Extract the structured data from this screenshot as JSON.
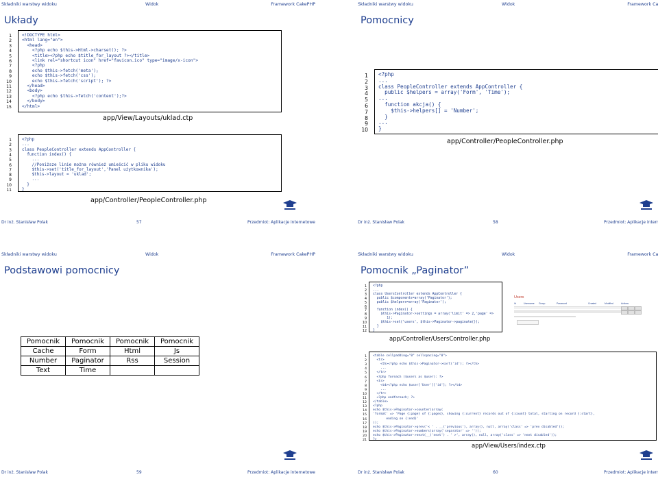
{
  "nav": {
    "left": "Składniki warstwy widoku",
    "mid": "Widok",
    "right": "Framework CakePHP"
  },
  "footer": {
    "author": "Dr inż. Stanisław Polak",
    "course": "Przedmiot: Aplikacje internetowe"
  },
  "slides": [
    {
      "title": "Układy",
      "page": "57",
      "code1": [
        "<!DOCTYPE html>",
        "<html lang=\"en\">",
        "  <head>",
        "    <?php echo $this->Html->charset(); ?>",
        "    <title><?php echo $title_for_layout ?></title>",
        "    <link rel=\"shortcut icon\" href=\"favicon.ico\" type=\"image/x-icon\">",
        "    <?php",
        "    echo $this->fetch('meta');",
        "    echo $this->fetch('css');",
        "    echo $this->fetch('script'); ?>",
        "  </head>",
        "  <body>",
        "    <?php echo $this->fetch('content');?>",
        "  </body>",
        "</html>"
      ],
      "caption1": "app/View/Layouts/uklad.ctp",
      "code2": [
        "<?php",
        "...",
        "class PeopleController extends AppController {",
        "  function index() {",
        "    ...",
        "    //Poniższe linie można również umieścić w pliku widoku",
        "    $this->set('title_for_layout','Panel użytkownika');",
        "    $this->layout = 'uklad';",
        "    ...",
        "  }",
        "}"
      ],
      "caption2": "app/Controller/PeopleController.php"
    },
    {
      "title": "Pomocnicy",
      "page": "58",
      "code": [
        "<?php",
        "...",
        "class PeopleController extends AppController {",
        "  public $helpers = array('Form', 'Time');",
        "...",
        "  function akcja() {",
        "    $this->helpers[] = 'Number';",
        "  }",
        "...",
        "}"
      ],
      "caption": "app/Controller/PeopleController.php"
    },
    {
      "title": "Podstawowi pomocnicy",
      "page": "59",
      "table": [
        [
          "Pomocnik",
          "Pomocnik",
          "Pomocnik",
          "Pomocnik"
        ],
        [
          "Cache",
          "Form",
          "Html",
          "Js"
        ],
        [
          "Number",
          "Paginator",
          "Rss",
          "Session"
        ],
        [
          "Text",
          "Time",
          "",
          ""
        ]
      ]
    },
    {
      "title": "Pomocnik „Paginator”",
      "page": "60",
      "code1": [
        "<?php",
        "...",
        "class UsersController extends AppController {",
        "  public $components=array('Paginator');",
        "  public $helpers=array('Paginator');",
        "",
        "  function index() {",
        "    $this->Paginator->settings = array('limit' => 2,'page' =>",
        "       1);",
        "    $this->set('users', $this->Paginator->paginate());",
        "  }",
        "}"
      ],
      "caption1": "app/Controller/UsersController.php",
      "code2": [
        "<table cellpadding=\"0\" cellspacing=\"0\">",
        "  <tr>",
        "    <th><?php echo $this->Paginator->sort('id'); ?></th>",
        "    ...",
        "  </tr>",
        "  <?php foreach ($users as $user): ?>",
        "  <tr>",
        "    <td><?php echo $user['User']['id']; ?></td>",
        "    ...",
        "  </tr>",
        "  <?php endforeach; ?>",
        "</table>",
        "<?php",
        "echo $this->Paginator->counter(array(",
        "'format' => 'Page {:page} of {:pages}, showing {:current} records out of {:count} total, starting on record {:start},",
        "       ending on {:end}'",
        "));",
        "echo $this->Paginator->prev('< ' . __('previous'), array(), null, array('class' => 'prev disabled'));",
        "echo $this->Paginator->numbers(array('separator' => ''));",
        "echo $this->Paginator->next(__('next') . ' >', array(), null, array('class' => 'next disabled'));",
        "?>"
      ],
      "caption2": "app/View/Users/index.ctp",
      "mini": {
        "heading": "Users",
        "headers": [
          "Id",
          "Username",
          "Group",
          "Password",
          "Created",
          "Modified",
          "Actions"
        ]
      }
    }
  ],
  "colors": {
    "accent": "#1f3f8f",
    "line": "#000000"
  }
}
